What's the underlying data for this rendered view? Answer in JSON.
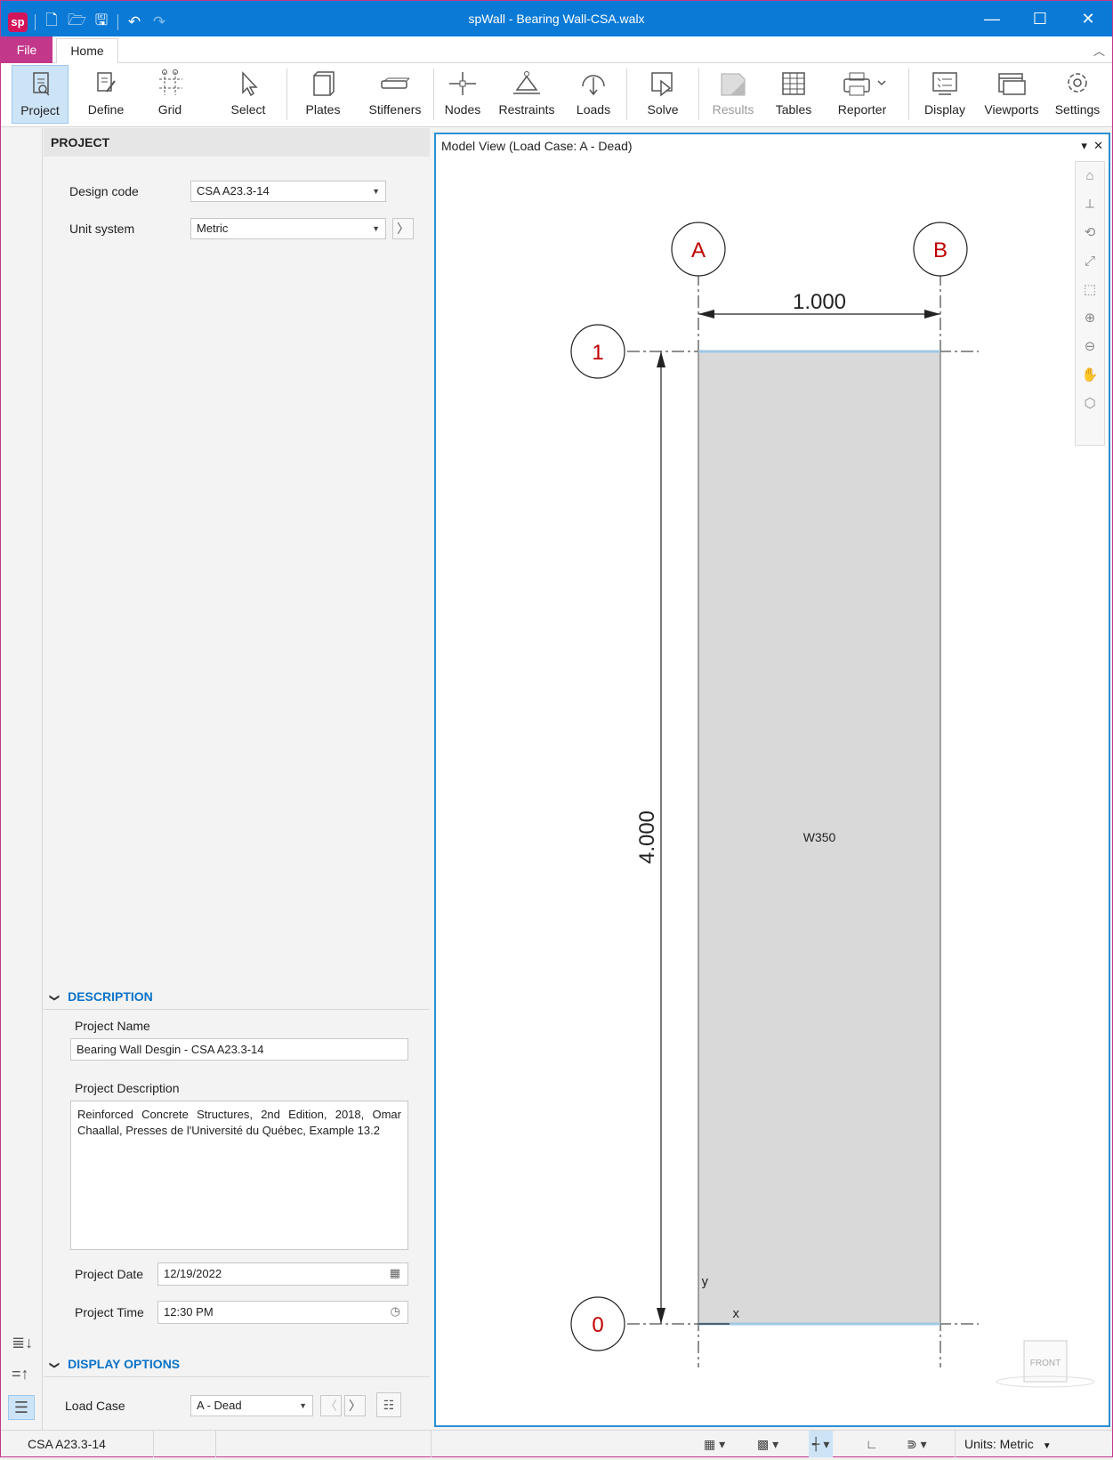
{
  "app": {
    "title": "spWall - Bearing Wall-CSA.walx",
    "logo_text": "sp"
  },
  "tabs": {
    "file": "File",
    "home": "Home"
  },
  "ribbon": {
    "buttons": [
      {
        "label": "Project",
        "icon": "project-icon"
      },
      {
        "label": "Define",
        "icon": "define-icon"
      },
      {
        "label": "Grid",
        "icon": "grid-icon"
      },
      {
        "label": "Select",
        "icon": "select-icon"
      },
      {
        "label": "Plates",
        "icon": "plates-icon"
      },
      {
        "label": "Stiffeners",
        "icon": "stiffeners-icon"
      },
      {
        "label": "Nodes",
        "icon": "nodes-icon"
      },
      {
        "label": "Restraints",
        "icon": "restraints-icon"
      },
      {
        "label": "Loads",
        "icon": "loads-icon"
      },
      {
        "label": "Solve",
        "icon": "solve-icon"
      },
      {
        "label": "Results",
        "icon": "results-icon"
      },
      {
        "label": "Tables",
        "icon": "tables-icon"
      },
      {
        "label": "Reporter",
        "icon": "reporter-icon"
      },
      {
        "label": "Display",
        "icon": "display-icon"
      },
      {
        "label": "Viewports",
        "icon": "viewports-icon"
      },
      {
        "label": "Settings",
        "icon": "settings-icon"
      }
    ]
  },
  "project_panel": {
    "header": "PROJECT",
    "design_code_label": "Design code",
    "design_code_value": "CSA A23.3-14",
    "unit_system_label": "Unit system",
    "unit_system_value": "Metric",
    "description": {
      "header": "DESCRIPTION",
      "project_name_label": "Project Name",
      "project_name_value": "Bearing Wall Desgin - CSA A23.3-14",
      "project_description_label": "Project Description",
      "project_description_value": "Reinforced Concrete Structures, 2nd Edition, 2018, Omar Chaallal, Presses de l'Université du Québec, Example 13.2",
      "project_date_label": "Project Date",
      "project_date_value": "12/19/2022",
      "project_time_label": "Project Time",
      "project_time_value": "12:30 PM"
    },
    "display_options": {
      "header": "DISPLAY OPTIONS",
      "load_case_label": "Load Case",
      "load_case_value": "A - Dead"
    }
  },
  "model_view": {
    "title": "Model View (Load Case: A - Dead)",
    "grid_labels": {
      "col_a": "A",
      "col_b": "B",
      "row_1": "1",
      "row_0": "0"
    },
    "width_dim": "1.000",
    "height_dim": "4.000",
    "plate_label": "W350",
    "axis_x": "x",
    "axis_y": "y",
    "view_cube": "FRONT"
  },
  "statusbar": {
    "design_code": "CSA A23.3-14",
    "units": "Units:  Metric"
  }
}
